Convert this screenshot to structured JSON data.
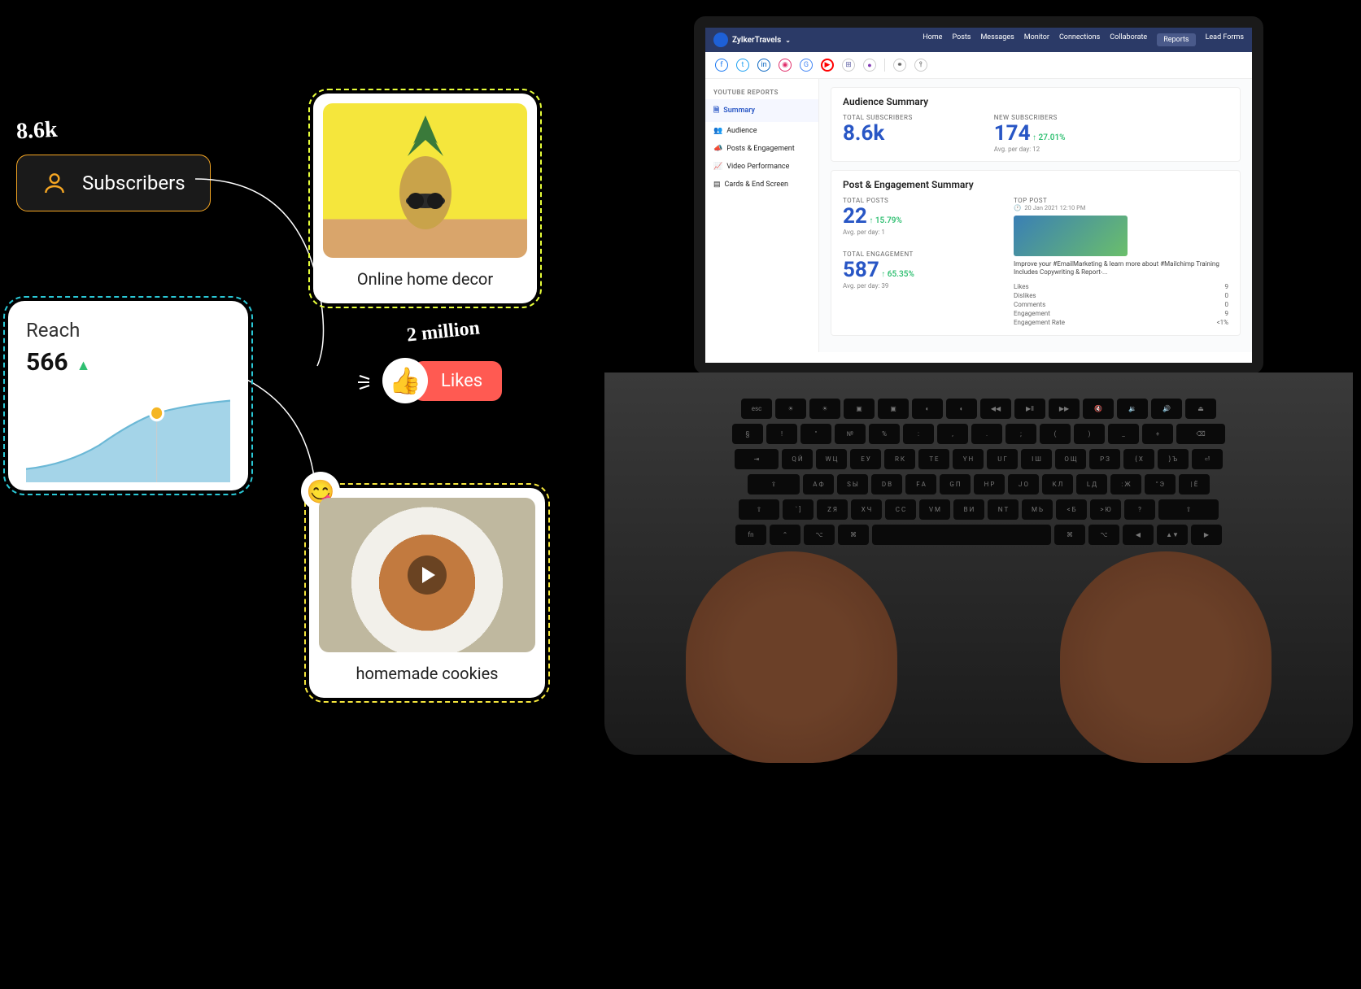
{
  "handwritten": {
    "subscribers_count": "8.6k",
    "likes_count": "2 million"
  },
  "subscribers_pill": {
    "label": "Subscribers"
  },
  "video1": {
    "caption": "Online home decor"
  },
  "video2": {
    "caption": "homemade cookies"
  },
  "reach": {
    "title": "Reach",
    "value": "566"
  },
  "likes": {
    "label": "Likes"
  },
  "chart_data": {
    "type": "area",
    "title": "Reach",
    "values": [
      80,
      110,
      160,
      260,
      380,
      420,
      450,
      480,
      520,
      566
    ],
    "ylim": [
      0,
      600
    ]
  },
  "dashboard": {
    "brand": "ZylkerTravels",
    "nav": [
      "Home",
      "Posts",
      "Messages",
      "Monitor",
      "Connections",
      "Collaborate",
      "Reports",
      "Lead Forms"
    ],
    "nav_active": "Reports",
    "sidebar": {
      "heading": "YOUTUBE REPORTS",
      "items": [
        "Summary",
        "Audience",
        "Posts & Engagement",
        "Video Performance",
        "Cards & End Screen"
      ],
      "active": "Summary"
    },
    "audience": {
      "title": "Audience Summary",
      "total_subscribers": {
        "label": "TOTAL SUBSCRIBERS",
        "value": "8.6k"
      },
      "new_subscribers": {
        "label": "NEW SUBSCRIBERS",
        "value": "174",
        "delta": "27.01%",
        "avg": "Avg. per day: 12"
      }
    },
    "engagement": {
      "title": "Post & Engagement Summary",
      "posts": {
        "label": "TOTAL POSTS",
        "value": "22",
        "delta": "15.79%",
        "avg": "Avg. per day: 1"
      },
      "total": {
        "label": "TOTAL ENGAGEMENT",
        "value": "587",
        "delta": "65.35%",
        "avg": "Avg. per day: 39"
      },
      "top_post": {
        "label": "TOP POST",
        "time": "20 Jan 2021 12:10 PM",
        "desc": "Improve your #EmailMarketing & learn more about #Mailchimp Training Includes Copywriting & Report-...",
        "stats": {
          "likes_label": "Likes",
          "likes_val": "9",
          "dislikes_label": "Dislikes",
          "dislikes_val": "0",
          "comments_label": "Comments",
          "comments_val": "0",
          "engagement_label": "Engagement",
          "engagement_val": "9",
          "rate_label": "Engagement Rate",
          "rate_val": "<1%"
        }
      }
    }
  }
}
